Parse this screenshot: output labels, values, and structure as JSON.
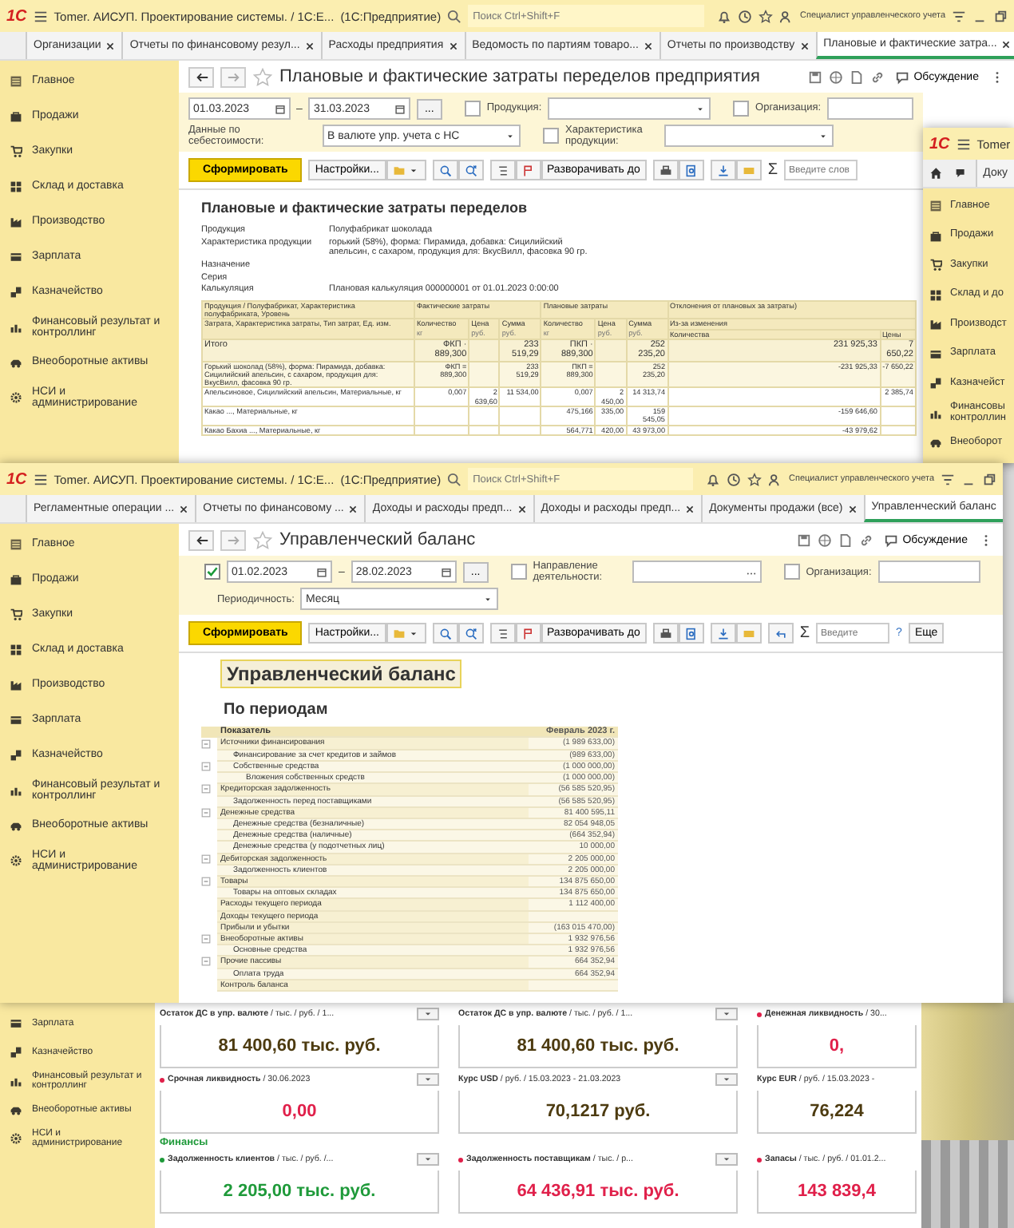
{
  "cost_window": {
    "header": {
      "logo": "1С",
      "title": "Tomer. АИСУП. Проектирование системы. / 1С:E...",
      "app": "(1С:Предприятие)",
      "search_placeholder": "Поиск Ctrl+Shift+F",
      "user": "Специалист управленческого учета"
    },
    "tabs": [
      {
        "label": "Организации",
        "selected": false
      },
      {
        "label": "Отчеты по финансовому резул...",
        "selected": false
      },
      {
        "label": "Расходы предприятия",
        "selected": false
      },
      {
        "label": "Ведомость по партиям товаро...",
        "selected": false
      },
      {
        "label": "Отчеты по производству",
        "selected": false
      },
      {
        "label": "Плановые и фактические затра...",
        "selected": true
      }
    ],
    "sidebar": [
      {
        "label": "Главное",
        "kind": "lines"
      },
      {
        "label": "Продажи",
        "kind": "bag"
      },
      {
        "label": "Закупки",
        "kind": "cart"
      },
      {
        "label": "Склад и доставка",
        "kind": "grid"
      },
      {
        "label": "Производство",
        "kind": "factory"
      },
      {
        "label": "Зарплата",
        "kind": "card"
      },
      {
        "label": "Казначейство",
        "kind": "coins"
      },
      {
        "label": "Финансовый результат и контроллинг",
        "kind": "chart"
      },
      {
        "label": "Внеоборотные активы",
        "kind": "car"
      },
      {
        "label": "НСИ и администрирование",
        "kind": "gear"
      }
    ],
    "title": "Плановые и фактические затраты переделов предприятия",
    "discussion": "Обсуждение",
    "period": {
      "from": "01.03.2023",
      "to": "31.03.2023",
      "dash": "–",
      "more": "..."
    },
    "cost_data": {
      "label": "Данные по себестоимости:",
      "value": "В валюте упр. учета с НС"
    },
    "options": [
      {
        "label": "Продукция:",
        "checked": false
      },
      {
        "label": "Характеристика продукции:",
        "checked": false
      },
      {
        "label": "Организация:",
        "checked": false
      }
    ],
    "toolbar": {
      "generate": "Сформировать",
      "settings": "Настройки...",
      "expand": "Разворачивать до",
      "sum": "Σ",
      "search_placeholder": "Введите слов"
    },
    "report": {
      "title": "Плановые и фактические затраты переделов",
      "params": [
        {
          "label": "Продукция",
          "value": "Полуфабрикат шоколада"
        },
        {
          "label": "Характеристика продукции",
          "value": "горький (58%), форма: Пирамида, добавка: Сицилийский апельсин, с сахаром, продукция для: ВкусВилл, фасовка 90 гр."
        },
        {
          "label": "Назначение"
        },
        {
          "label": "Серия"
        },
        {
          "label": "Калькуляция",
          "value": "Плановая калькуляция 000000001 от 01.01.2023 0:00:00"
        }
      ],
      "table": {
        "first_header": "Продукция / Полуфабрикат, Характеристика полуфабриката, Уровень",
        "second_header": "Затрата, Характеристика затраты, Тип затрат, Ед. изм.",
        "groups": [
          {
            "label": "Фактические затраты",
            "columns": [
              {
                "label": "Количество",
                "unit": "кг"
              },
              {
                "label": "Цена",
                "unit": "руб."
              },
              {
                "label": "Сумма",
                "unit": "руб."
              }
            ]
          },
          {
            "label": "Плановые затраты",
            "columns": [
              {
                "label": "Количество",
                "unit": "кг"
              },
              {
                "label": "Цена",
                "unit": "руб."
              },
              {
                "label": "Сумма",
                "unit": "руб."
              }
            ]
          },
          {
            "label": "Отклонения от плановых за затраты)",
            "sublabel": "Из-за изменения",
            "columns": [
              {
                "label": "Количества"
              },
              {
                "label": "Цены"
              }
            ]
          }
        ],
        "rows": [
          {
            "kind": "total",
            "cells": [
              "Итого",
              "ФКП · 889,300",
              "",
              "233 519,29",
              "ПКП · 889,300",
              "",
              "252 235,20",
              "231 925,33",
              "7 650,22"
            ]
          },
          {
            "kind": "product",
            "cells": [
              "Горький шоколад (58%), форма: Пирамида, добавка: Сицилийский апельсин, с сахаром, продукция для: ВкусВилл, фасовка 90 гр.",
              "ФКП = 889,300",
              "",
              "233 519,29",
              "ПКП = 889,300",
              "",
              "252 235,20",
              "-231 925,33",
              "-7 650,22"
            ]
          },
          {
            "kind": "item",
            "cells": [
              "Апельсиновое, Сицилийский апельсин, Материальные, кг",
              "0,007",
              "2 639,60",
              "11 534,00",
              "0,007",
              "2 450,00",
              "14 313,74",
              "",
              "2 385,74"
            ]
          },
          {
            "kind": "item",
            "cells": [
              "Какао ..., Материальные, кг",
              "",
              "",
              "",
              "475,166",
              "335,00",
              "159 545,05",
              "-159 646,60",
              ""
            ]
          },
          {
            "kind": "item",
            "cells": [
              "Какао Бахиа ..., Материальные, кг",
              "",
              "",
              "",
              "564,771",
              "420,00",
              "43 973,00",
              "-43 979,62",
              ""
            ]
          }
        ]
      }
    }
  },
  "side_window": {
    "header": {
      "logo": "1С",
      "title": "Tomer"
    },
    "tabs": [
      {
        "label": "Доку",
        "selected": false
      }
    ],
    "sidebar": [
      {
        "label": "Главное",
        "kind": "lines"
      },
      {
        "label": "Продажи",
        "kind": "bag"
      },
      {
        "label": "Закупки",
        "kind": "cart"
      },
      {
        "label": "Склад и до",
        "kind": "grid"
      },
      {
        "label": "Производст",
        "kind": "factory"
      },
      {
        "label": "Зарплата",
        "kind": "card"
      },
      {
        "label": "Казначейст",
        "kind": "coins"
      },
      {
        "label": "Финансовы контроллин",
        "kind": "chart"
      },
      {
        "label": "Внеоборот",
        "kind": "car"
      }
    ]
  },
  "balance_window": {
    "header": {
      "logo": "1С",
      "title": "Tomer. АИСУП. Проектирование системы. / 1С:E...",
      "app": "(1С:Предприятие)",
      "search_placeholder": "Поиск Ctrl+Shift+F",
      "user": "Специалист управленческого учета"
    },
    "tabs": [
      {
        "label": "Регламентные операции ...",
        "selected": false
      },
      {
        "label": "Отчеты по финансовому ...",
        "selected": false
      },
      {
        "label": "Доходы и расходы предп...",
        "selected": false
      },
      {
        "label": "Доходы и расходы предп...",
        "selected": false
      },
      {
        "label": "Документы продажи (все)",
        "selected": false
      },
      {
        "label": "Управленческий баланс",
        "selected": true
      }
    ],
    "sidebar": [
      {
        "label": "Главное",
        "kind": "lines"
      },
      {
        "label": "Продажи",
        "kind": "bag"
      },
      {
        "label": "Закупки",
        "kind": "cart"
      },
      {
        "label": "Склад и доставка",
        "kind": "grid"
      },
      {
        "label": "Производство",
        "kind": "factory"
      },
      {
        "label": "Зарплата",
        "kind": "card"
      },
      {
        "label": "Казначейство",
        "kind": "coins"
      },
      {
        "label": "Финансовый результат и контроллинг",
        "kind": "chart"
      },
      {
        "label": "Внеоборотные активы",
        "kind": "car"
      },
      {
        "label": "НСИ и администрирование",
        "kind": "gear"
      }
    ],
    "title": "Управленческий баланс",
    "discussion": "Обсуждение",
    "period": {
      "checked": true,
      "from": "01.02.2023",
      "to": "28.02.2023",
      "dash": "–",
      "more": "..."
    },
    "options": [
      {
        "label": "Направление деятельности:",
        "checked": false
      },
      {
        "label": "Организация:",
        "checked": false
      }
    ],
    "periodicity": {
      "label": "Периодичность:",
      "value": "Месяц"
    },
    "toolbar": {
      "generate": "Сформировать",
      "settings": "Настройки...",
      "expand": "Разворачивать до",
      "sum": "Σ",
      "search_placeholder": "Введите",
      "help": "?",
      "more": "Еще"
    },
    "report": {
      "title": "Управленческий баланс",
      "subtitle": "По периодам",
      "columns": [
        "Показатель",
        "Февраль 2023 г."
      ],
      "rows": [
        {
          "label": "Источники финансирования",
          "value": "(1 989 633,00)",
          "expanded": true,
          "children": [
            {
              "label": "Финансирование за счет кредитов и займов",
              "value": "(989 633,00)"
            },
            {
              "label": "Собственные средства",
              "value": "(1 000 000,00)",
              "expanded": true,
              "children": [
                {
                  "label": "Вложения собственных средств",
                  "value": "(1 000 000,00)"
                }
              ]
            }
          ]
        },
        {
          "label": "Кредиторская задолженность",
          "value": "(56 585 520,95)",
          "expanded": true,
          "children": [
            {
              "label": "Задолженность перед поставщиками",
              "value": "(56 585 520,95)"
            }
          ]
        },
        {
          "label": "Денежные средства",
          "value": "81 400 595,11",
          "expanded": true,
          "children": [
            {
              "label": "Денежные средства (безналичные)",
              "value": "82 054 948,05"
            },
            {
              "label": "Денежные средства (наличные)",
              "value": "(664 352,94)"
            },
            {
              "label": "Денежные средства (у подотчетных лиц)",
              "value": "10 000,00"
            }
          ]
        },
        {
          "label": "Дебиторская задолженность",
          "value": "2 205 000,00",
          "expanded": true,
          "children": [
            {
              "label": "Задолженность клиентов",
              "value": "2 205 000,00"
            }
          ]
        },
        {
          "label": "Товары",
          "value": "134 875 650,00",
          "expanded": true,
          "children": [
            {
              "label": "Товары на оптовых складах",
              "value": "134 875 650,00"
            }
          ]
        },
        {
          "label": "Расходы текущего периода",
          "value": "1 112 400,00"
        },
        {
          "label": "Доходы текущего периода"
        },
        {
          "label": "Прибыли и убытки",
          "value": "(163 015 470,00)"
        },
        {
          "label": "Внеоборотные активы",
          "value": "1 932 976,56",
          "expanded": true,
          "children": [
            {
              "label": "Основные средства",
              "value": "1 932 976,56"
            }
          ]
        },
        {
          "label": "Прочие пассивы",
          "value": "664 352,94",
          "expanded": true,
          "children": [
            {
              "label": "Оплата труда",
              "value": "664 352,94"
            }
          ]
        },
        {
          "label": "Контроль баланса"
        }
      ]
    }
  },
  "dashboard": {
    "sidebar": [
      {
        "label": "Зарплата",
        "kind": "card"
      },
      {
        "label": "Казначейство",
        "kind": "coins"
      },
      {
        "label": "Финансовый результат и контроллинг",
        "kind": "chart"
      },
      {
        "label": "Внеоборотные активы",
        "kind": "car"
      },
      {
        "label": "НСИ и администрирование",
        "kind": "gear"
      }
    ],
    "sections": [
      {
        "widgets": [
          {
            "title": "**Остаток ДС в упр. валюте** / тыс. / руб. / 1...",
            "value": "81 400,60 тыс. руб.",
            "dot": false,
            "color": "#4d3b10"
          },
          {
            "title": "**Остаток ДС в упр. валюте** / тыс. / руб. / 1...",
            "value": "81 400,60 тыс. руб.",
            "dot": false,
            "color": "#4d3b10"
          },
          {
            "title": "**Денежная ликвидность** / 30...",
            "value": "0,",
            "dot": true,
            "color": "#e0204a"
          }
        ]
      },
      {
        "widgets": [
          {
            "title": "**Срочная ликвидность** / 30.06.2023",
            "value": "0,00",
            "dot": true,
            "color": "#e0204a"
          },
          {
            "title": "**Курс USD** / руб. / 15.03.2023 - 21.03.2023",
            "value": "70,1217 руб.",
            "dot": false,
            "color": "#4d3b10"
          },
          {
            "title": "**Курс EUR** / руб. / 15.03.2023 -",
            "value": "76,224",
            "dot": false,
            "color": "#4d3b10"
          }
        ]
      },
      {
        "heading": "Финансы",
        "widgets": [
          {
            "title": "**Задолженность клиентов** / тыс. / руб. /...",
            "value": "2 205,00 тыс. руб.",
            "dot": true,
            "color": "#1f9a3a"
          },
          {
            "title": "**Задолженность поставщикам** / тыс. / р...",
            "value": "64 436,91 тыс. руб.",
            "dot": true,
            "color": "#e0204a"
          },
          {
            "title": "**Запасы** / тыс. / руб. / 01.01.2...",
            "value": "143 839,4",
            "dot": true,
            "color": "#e0204a"
          }
        ]
      }
    ]
  }
}
